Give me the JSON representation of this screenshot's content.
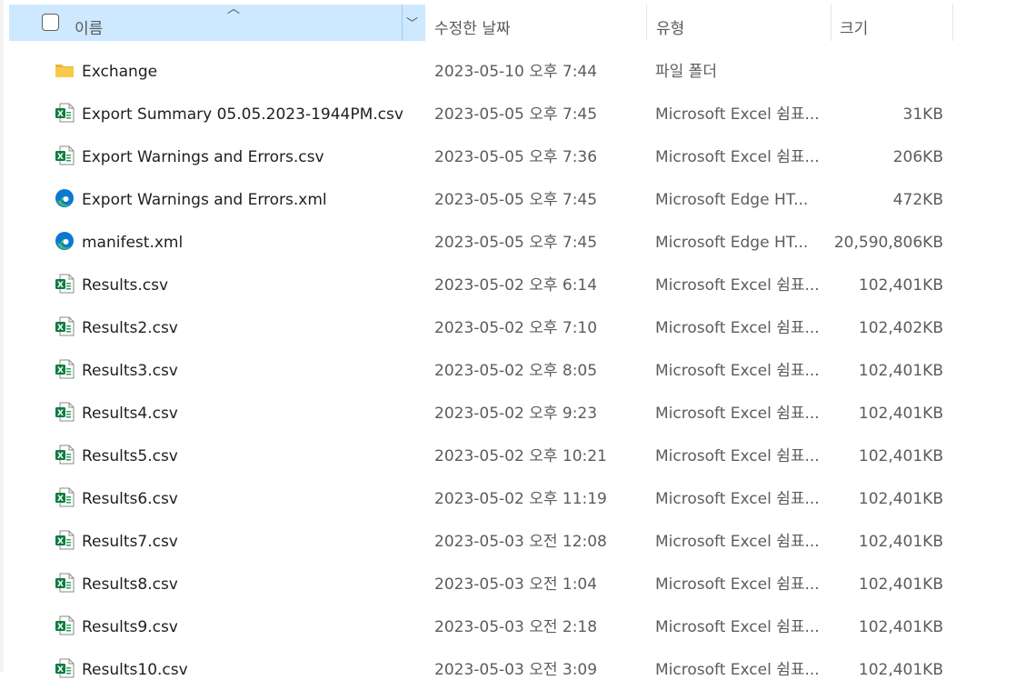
{
  "columns": {
    "name": "이름",
    "date": "수정한 날짜",
    "type": "유형",
    "size": "크기"
  },
  "files": [
    {
      "icon": "folder-icon",
      "name": "Exchange",
      "date": "2023-05-10 오후 7:44",
      "type": "파일 폴더",
      "size": ""
    },
    {
      "icon": "excel-icon",
      "name": "Export Summary 05.05.2023-1944PM.csv",
      "date": "2023-05-05 오후 7:45",
      "type": "Microsoft Excel 쉼표...",
      "size": "31KB"
    },
    {
      "icon": "excel-icon",
      "name": "Export Warnings and Errors.csv",
      "date": "2023-05-05 오후 7:36",
      "type": "Microsoft Excel 쉼표...",
      "size": "206KB"
    },
    {
      "icon": "edge-icon",
      "name": "Export Warnings and Errors.xml",
      "date": "2023-05-05 오후 7:45",
      "type": "Microsoft Edge HT...",
      "size": "472KB"
    },
    {
      "icon": "edge-icon",
      "name": "manifest.xml",
      "date": "2023-05-05 오후 7:45",
      "type": "Microsoft Edge HT...",
      "size": "20,590,806KB"
    },
    {
      "icon": "excel-icon",
      "name": "Results.csv",
      "date": "2023-05-02 오후 6:14",
      "type": "Microsoft Excel 쉼표...",
      "size": "102,401KB"
    },
    {
      "icon": "excel-icon",
      "name": "Results2.csv",
      "date": "2023-05-02 오후 7:10",
      "type": "Microsoft Excel 쉼표...",
      "size": "102,402KB"
    },
    {
      "icon": "excel-icon",
      "name": "Results3.csv",
      "date": "2023-05-02 오후 8:05",
      "type": "Microsoft Excel 쉼표...",
      "size": "102,401KB"
    },
    {
      "icon": "excel-icon",
      "name": "Results4.csv",
      "date": "2023-05-02 오후 9:23",
      "type": "Microsoft Excel 쉼표...",
      "size": "102,401KB"
    },
    {
      "icon": "excel-icon",
      "name": "Results5.csv",
      "date": "2023-05-02 오후 10:21",
      "type": "Microsoft Excel 쉼표...",
      "size": "102,401KB"
    },
    {
      "icon": "excel-icon",
      "name": "Results6.csv",
      "date": "2023-05-02 오후 11:19",
      "type": "Microsoft Excel 쉼표...",
      "size": "102,401KB"
    },
    {
      "icon": "excel-icon",
      "name": "Results7.csv",
      "date": "2023-05-03 오전 12:08",
      "type": "Microsoft Excel 쉼표...",
      "size": "102,401KB"
    },
    {
      "icon": "excel-icon",
      "name": "Results8.csv",
      "date": "2023-05-03 오전 1:04",
      "type": "Microsoft Excel 쉼표...",
      "size": "102,401KB"
    },
    {
      "icon": "excel-icon",
      "name": "Results9.csv",
      "date": "2023-05-03 오전 2:18",
      "type": "Microsoft Excel 쉼표...",
      "size": "102,401KB"
    },
    {
      "icon": "excel-icon",
      "name": "Results10.csv",
      "date": "2023-05-03 오전 3:09",
      "type": "Microsoft Excel 쉼표...",
      "size": "102,401KB"
    }
  ],
  "colors": {
    "header_selected_bg": "#cde8ff",
    "excel_green": "#107c41",
    "folder_yellow": "#f8c94a",
    "edge_blue": "#0c78d4",
    "edge_green": "#3fbf5a"
  }
}
